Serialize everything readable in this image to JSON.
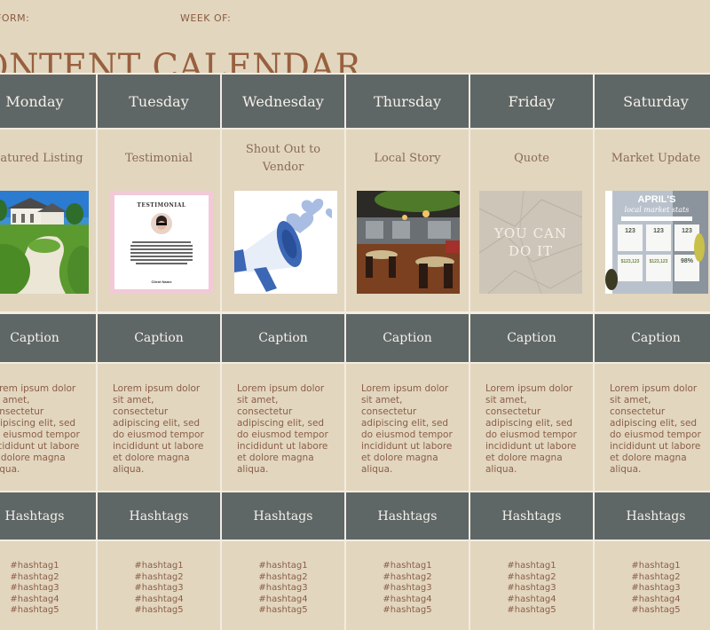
{
  "header": {
    "platform_label": "FORM:",
    "week_label": "WEEK OF:",
    "title": "ONTENT CALENDAR"
  },
  "days": [
    {
      "name": "Monday",
      "post_type": "Featured Listing",
      "image": "luxury-home-photo",
      "caption_header": "Caption",
      "caption_lines": [
        "Lorem ipsum dolor",
        "sit amet,",
        "consectetur",
        "adipiscing elit, sed",
        "do eiusmod tempor",
        "incididunt ut labore",
        "et dolore magna",
        "aliqua."
      ],
      "hashtags_header": "Hashtags",
      "hashtags": [
        "#hashtag1",
        "#hashtag2",
        "#hashtag3",
        "#hashtag4",
        "#hashtag5"
      ]
    },
    {
      "name": "Tuesday",
      "post_type": "Testimonial",
      "image": "testimonial-card",
      "image_title": "TESTIMONIAL",
      "image_client": "Client Name",
      "caption_header": "Caption",
      "caption_lines": [
        "Lorem ipsum dolor",
        "sit amet,",
        "consectetur",
        "adipiscing elit, sed",
        "do eiusmod tempor",
        "incididunt ut labore",
        "et dolore magna",
        "aliqua."
      ],
      "hashtags_header": "Hashtags",
      "hashtags": [
        "#hashtag1",
        "#hashtag2",
        "#hashtag3",
        "#hashtag4",
        "#hashtag5"
      ]
    },
    {
      "name": "Wednesday",
      "post_type_lines": [
        "Shout Out to",
        "Vendor"
      ],
      "image": "megaphone-hearts-illustration",
      "caption_header": "Caption",
      "caption_lines": [
        "Lorem ipsum dolor",
        "sit amet,",
        "consectetur",
        "adipiscing elit, sed",
        "do eiusmod tempor",
        "incididunt ut labore",
        "et dolore magna",
        "aliqua."
      ],
      "hashtags_header": "Hashtags",
      "hashtags": [
        "#hashtag1",
        "#hashtag2",
        "#hashtag3",
        "#hashtag4",
        "#hashtag5"
      ]
    },
    {
      "name": "Thursday",
      "post_type": "Local Story",
      "image": "restaurant-interior-photo",
      "caption_header": "Caption",
      "caption_lines": [
        "Lorem ipsum dolor",
        "sit amet,",
        "consectetur",
        "adipiscing elit, sed",
        "do eiusmod tempor",
        "incididunt ut labore",
        "et dolore magna",
        "aliqua."
      ],
      "hashtags_header": "Hashtags",
      "hashtags": [
        "#hashtag1",
        "#hashtag2",
        "#hashtag3",
        "#hashtag4",
        "#hashtag5"
      ]
    },
    {
      "name": "Friday",
      "post_type": "Quote",
      "image": "crumpled-paper-quote",
      "image_text_lines": [
        "YOU CAN",
        "DO IT"
      ],
      "caption_header": "Caption",
      "caption_lines": [
        "Lorem ipsum dolor",
        "sit amet,",
        "consectetur",
        "adipiscing elit, sed",
        "do eiusmod tempor",
        "incididunt ut labore",
        "et dolore magna",
        "aliqua."
      ],
      "hashtags_header": "Hashtags",
      "hashtags": [
        "#hashtag1",
        "#hashtag2",
        "#hashtag3",
        "#hashtag4",
        "#hashtag5"
      ]
    },
    {
      "name": "Saturday",
      "post_type": "Market Update",
      "image": "market-stats-graphic",
      "image_title": "APRIL'S",
      "image_subtitle": "local market stats",
      "image_stats": [
        "123",
        "123",
        "123",
        "$123,123",
        "$123,123",
        "98%"
      ],
      "caption_header": "Caption",
      "caption_lines": [
        "Lorem ipsum dolor",
        "sit amet,",
        "consectetur",
        "adipiscing elit, sed",
        "do eiusmod tempor",
        "incididunt ut labore",
        "et dolore magna",
        "aliqua."
      ],
      "hashtags_header": "Hashtags",
      "hashtags": [
        "#hashtag1",
        "#hashtag2",
        "#hashtag3",
        "#hashtag4",
        "#hashtag5"
      ]
    }
  ],
  "colors": {
    "background": "#e2d6bf",
    "header_fill": "#5f6666",
    "title_brown": "#98603e",
    "body_text": "#8b5e47",
    "grid_line": "#f2ece0"
  }
}
